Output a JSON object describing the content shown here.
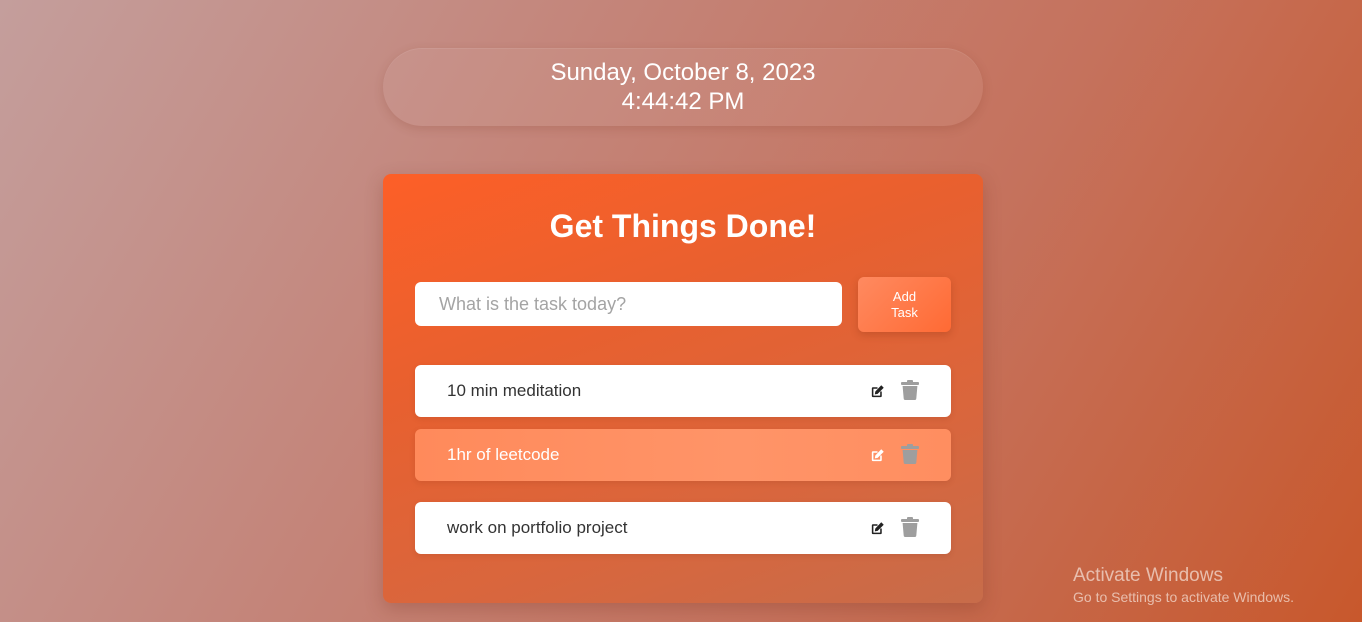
{
  "clock": {
    "date": "Sunday, October 8, 2023",
    "time": "4:44:42 PM"
  },
  "app": {
    "title": "Get Things Done!",
    "input": {
      "placeholder": "What is the task today?",
      "value": ""
    },
    "add_button_label": "Add Task"
  },
  "tasks": [
    {
      "label": "10 min meditation",
      "edit_icon": "edit-icon",
      "delete_icon": "trash-icon"
    },
    {
      "label": "1hr of leetcode",
      "edit_icon": "edit-icon",
      "delete_icon": "trash-icon"
    },
    {
      "label": "work on portfolio project",
      "edit_icon": "edit-icon",
      "delete_icon": "trash-icon"
    }
  ],
  "watermark": {
    "title": "Activate Windows",
    "subtitle": "Go to Settings to activate Windows."
  },
  "colors": {
    "accent": "#fd5f27",
    "button": "#ff6a34",
    "highlight_row": "#ff8a5b",
    "text_dark": "#333333",
    "icon_gray": "#9e9e9e"
  }
}
